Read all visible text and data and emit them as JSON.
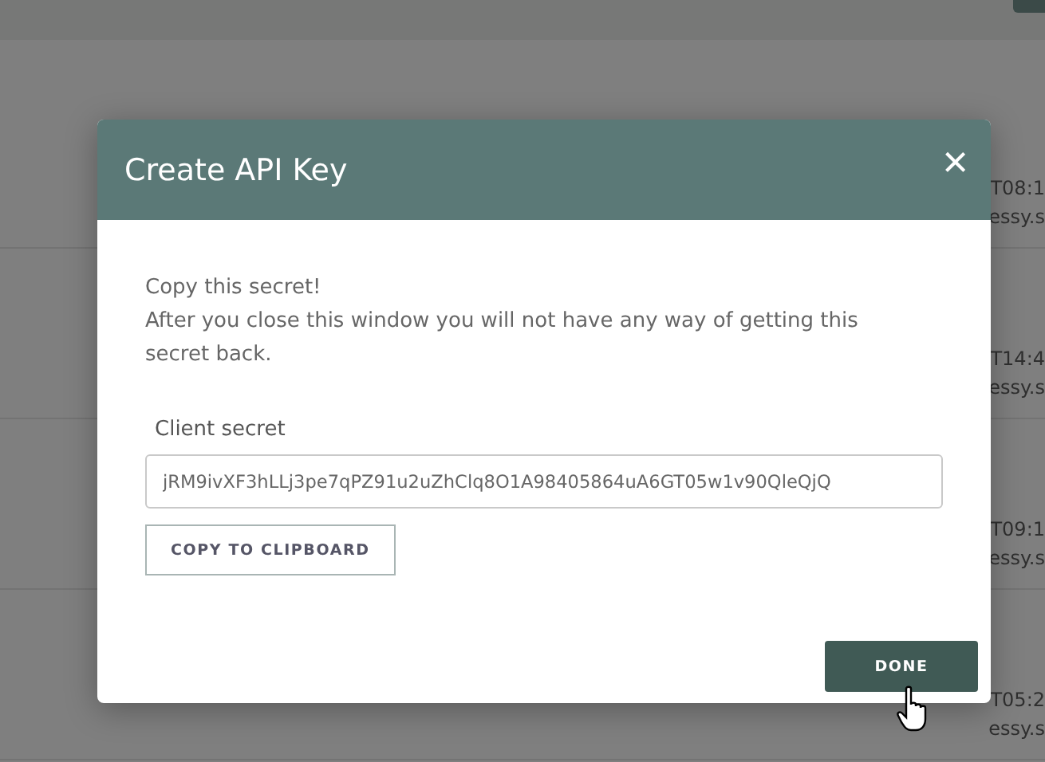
{
  "background_rows": [
    {
      "time": "T08:1",
      "domain": "essy.s"
    },
    {
      "time": "T14:4",
      "domain": "essy.s"
    },
    {
      "time": "T09:1",
      "domain": "essy.s"
    },
    {
      "time": "T05:2",
      "domain": "essy.s"
    }
  ],
  "dialog": {
    "title": "Create API Key",
    "close": "×",
    "message_lines": [
      "Copy this secret!",
      "After you close this window you will not have any way of getting this secret back."
    ],
    "field": {
      "label": "Client secret",
      "value": "jRM9ivXF3hLLj3pe7qPZ91u2uZhClq8O1A98405864uA6GT05w1v90QleQjQ"
    },
    "copy_button": "COPY TO CLIPBOARD",
    "done_button": "DONE"
  }
}
